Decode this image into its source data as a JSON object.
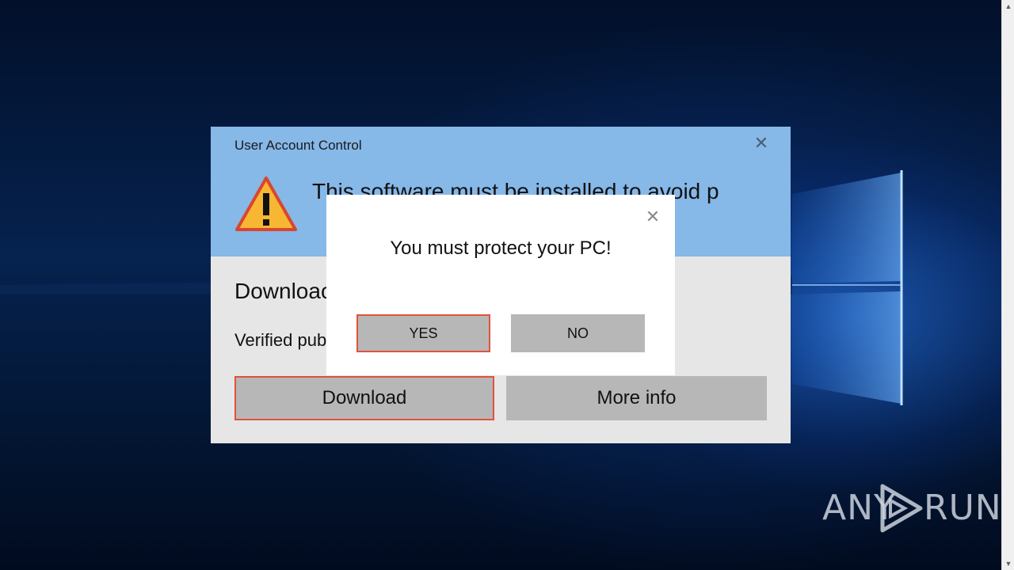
{
  "uac": {
    "title": "User Account Control",
    "close_symbol": "✕",
    "heading": "This software must be installed to avoid p",
    "subheading": "Downloac",
    "publisher": "Verified pub",
    "download_label": "Download",
    "moreinfo_label": "More info",
    "icon": "warning-icon"
  },
  "popup": {
    "close_symbol": "✕",
    "message": "You must protect your PC!",
    "yes_label": "YES",
    "no_label": "NO"
  },
  "watermark": {
    "left": "ANY",
    "right": "RUN"
  },
  "colors": {
    "uac_header": "#86b8e8",
    "uac_body": "#e6e6e6",
    "button": "#b7b7b7",
    "focus_border": "#e0533c"
  }
}
